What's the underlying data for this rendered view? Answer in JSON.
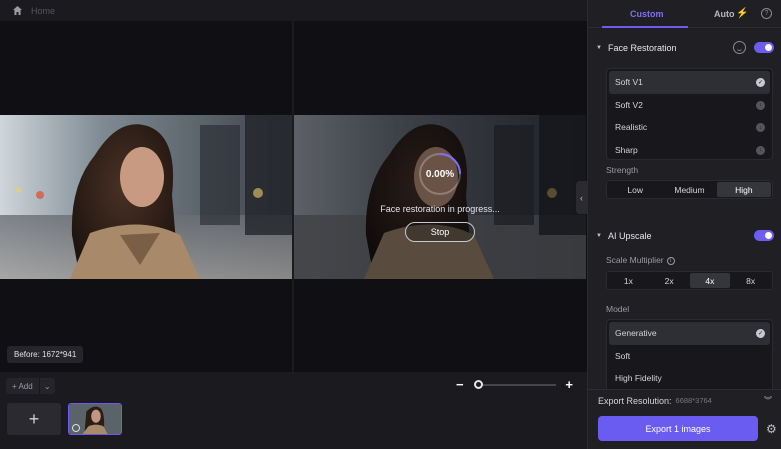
{
  "topbar": {
    "breadcrumb": "Home"
  },
  "preview": {
    "progress": "0.00%",
    "message": "Face restoration in progress...",
    "stop_label": "Stop",
    "before_badge": "Before: 1672*941"
  },
  "bottom": {
    "add_label": "+ Add",
    "add_dropdown": "⌄",
    "zoom_minus": "−",
    "zoom_plus": "+",
    "big_add": "+"
  },
  "panel": {
    "tabs": {
      "custom": "Custom",
      "auto": "Auto"
    },
    "help": "?",
    "face_restoration": {
      "title": "Face Restoration",
      "items": [
        {
          "label": "Soft V1",
          "state": "selected"
        },
        {
          "label": "Soft V2",
          "state": "download"
        },
        {
          "label": "Realistic",
          "state": "download"
        },
        {
          "label": "Sharp",
          "state": "download"
        }
      ],
      "strength_label": "Strength",
      "strength": [
        "Low",
        "Medium",
        "High"
      ]
    },
    "ai_upscale": {
      "title": "AI Upscale",
      "scale_label": "Scale Multiplier",
      "scales": [
        "1x",
        "2x",
        "4x",
        "8x"
      ],
      "model_label": "Model",
      "models": [
        "Generative",
        "Soft",
        "High Fidelity"
      ]
    },
    "export_resolution_label": "Export Resolution:",
    "export_resolution_value": "6688*3764",
    "export_button": "Export 1 images"
  },
  "colors": {
    "accent": "#6c5cf0",
    "bolt": "#f0c23a"
  }
}
